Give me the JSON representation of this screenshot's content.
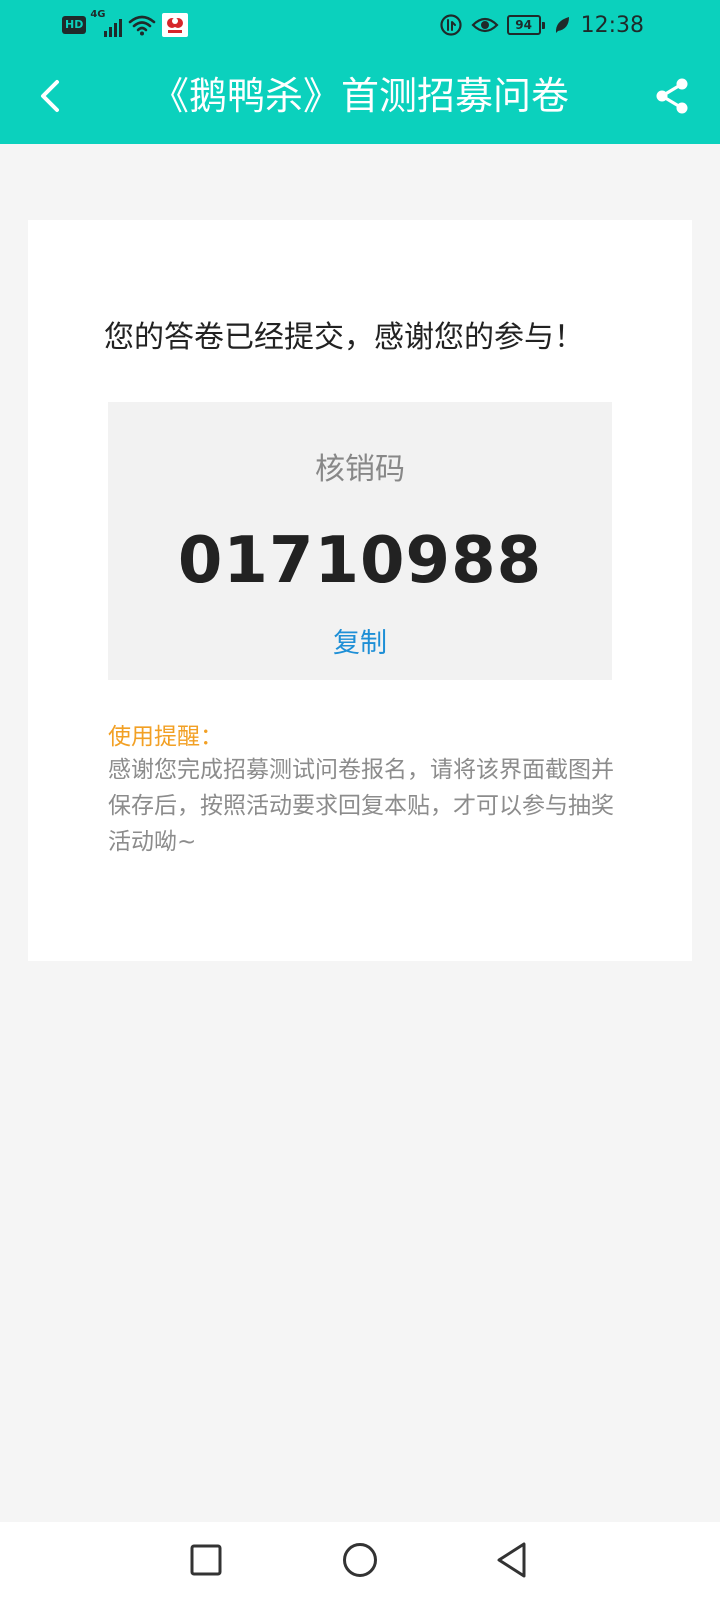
{
  "status_bar": {
    "hd_label": "HD",
    "network_label": "4G",
    "battery_level": "94",
    "time": "12:38",
    "icons": [
      "hd-icon",
      "signal-icon",
      "wifi-icon",
      "app-notification-icon",
      "data-saver-icon",
      "eye-comfort-icon",
      "battery-icon",
      "leaf-icon"
    ]
  },
  "header": {
    "title": "《鹅鸭杀》首测招募问卷",
    "back_icon": "chevron-left-icon",
    "share_icon": "share-icon",
    "color": "#0bd1bd"
  },
  "main": {
    "success_message": "您的答卷已经提交，感谢您的参与！",
    "code_label": "核销码",
    "code_value": "01710988",
    "copy_label": "复制",
    "reminder_title": "使用提醒：",
    "reminder_text": "感谢您完成招募测试问卷报名，请将该界面截图并保存后，按照活动要求回复本贴，才可以参与抽奖活动呦~"
  },
  "colors": {
    "accent": "#0bd1bd",
    "link": "#1e8fd6",
    "reminder": "#f2a024",
    "background": "#f5f5f5"
  },
  "nav_bar": {
    "icons": [
      "recent-apps-icon",
      "home-icon",
      "back-triangle-icon"
    ]
  }
}
